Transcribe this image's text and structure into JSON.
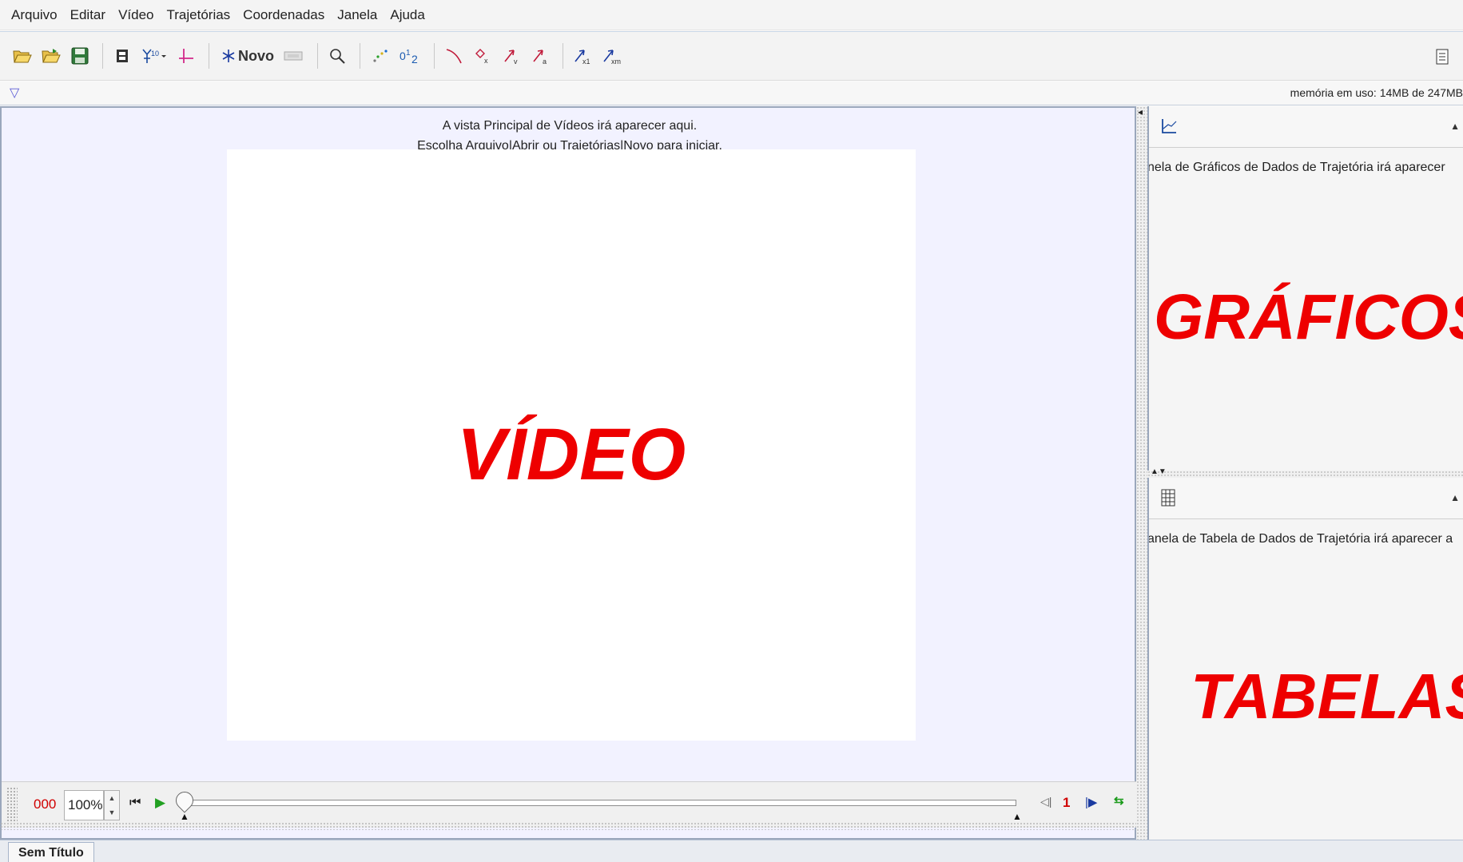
{
  "menu": [
    "Arquivo",
    "Editar",
    "Vídeo",
    "Trajetórias",
    "Coordenadas",
    "Janela",
    "Ajuda"
  ],
  "toolbar": {
    "new_track_label": "Novo"
  },
  "status": {
    "memory": "memória em uso: 14MB de 247MB"
  },
  "main": {
    "hint_line1": "A vista Principal de Vídeos irá aparecer aqui.",
    "hint_line2": "Escolha Arquivo|Abrir ou Trajetórias|Novo para iniciar.",
    "overlay_label": "VÍDEO"
  },
  "player": {
    "frame_counter": "000",
    "zoom": "100%",
    "step_size": "1"
  },
  "graphs": {
    "message": "nela de Gráficos de Dados de Trajetória irá aparecer",
    "overlay_label": "GRÁFICOS"
  },
  "tables": {
    "message": "anela de Tabela de Dados de Trajetória irá aparecer a",
    "overlay_label": "TABELAS"
  },
  "tabs": [
    "Sem Título"
  ],
  "colors": {
    "overlay_red": "#ee0000",
    "panel_background": "#f2f2ff",
    "counter_red": "#d00000"
  }
}
